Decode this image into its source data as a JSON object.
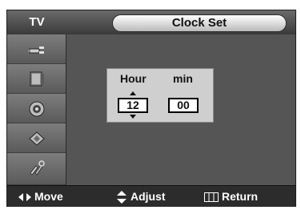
{
  "osd": {
    "source_label": "TV",
    "title": "Clock Set"
  },
  "sidebar": {
    "items": [
      {
        "icon": "antenna-icon"
      },
      {
        "icon": "picture-icon"
      },
      {
        "icon": "speaker-icon"
      },
      {
        "icon": "channel-chip-icon"
      },
      {
        "icon": "setup-tools-icon"
      }
    ]
  },
  "clock_set": {
    "hour_label": "Hour",
    "min_label": "min",
    "hour_value": "12",
    "min_value": "00"
  },
  "footer": {
    "move_label": "Move",
    "adjust_label": "Adjust",
    "return_label": "Return"
  }
}
